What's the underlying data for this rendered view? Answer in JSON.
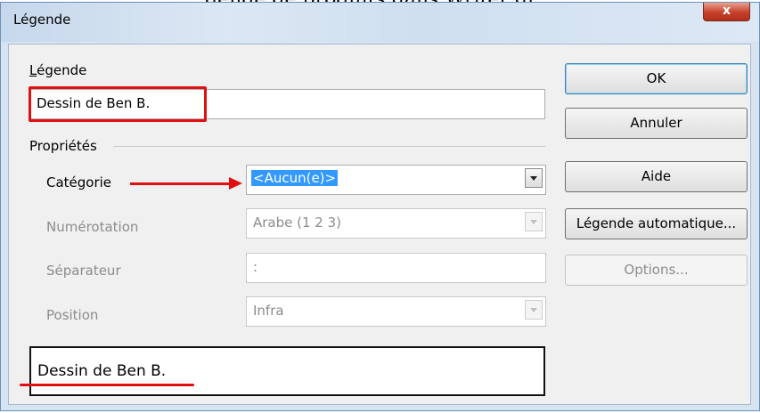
{
  "window": {
    "title": "Légende",
    "close_symbol": "x"
  },
  "caption_label": "Légende",
  "caption_value": "Dessin de Ben B.",
  "properties_label": "Propriétés",
  "category": {
    "label": "Catégorie",
    "value": "<Aucun(e)>"
  },
  "numbering": {
    "label": "Numérotation",
    "value": "Arabe (1 2 3)"
  },
  "separator": {
    "label": "Séparateur",
    "value": ":"
  },
  "position": {
    "label": "Position",
    "value": "Infra"
  },
  "preview_text": "Dessin de Ben B.",
  "buttons": {
    "ok": "OK",
    "cancel": "Annuler",
    "help": "Aide",
    "autocaption": "Légende automatique...",
    "options": "Options..."
  },
  "annotation_color": "#e01010",
  "icons": {
    "close": "close-icon",
    "dropdown": "chevron-down-icon"
  }
}
